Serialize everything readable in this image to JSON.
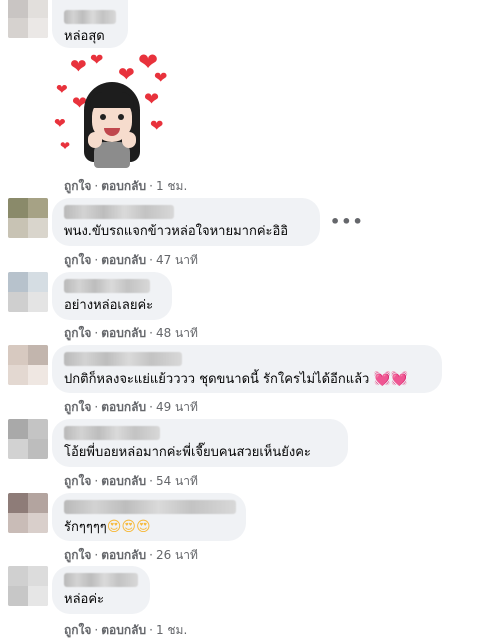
{
  "labels": {
    "like": "ถูกใจ",
    "reply": "ตอบกลับ",
    "separator": "·"
  },
  "comments": [
    {
      "text": "หล่อสุด",
      "time": ""
    },
    {
      "text": "",
      "time": "1 ชม.",
      "sticker": "heart-eyes-girl-avatar-sticker"
    },
    {
      "text": "พนง.ขับรถแจกข้าวหล่อใจหายมากค่ะอิอิ",
      "time": "47 นาที",
      "more": "•••"
    },
    {
      "text": "อย่างหล่อเลยค่ะ",
      "time": "48 นาที"
    },
    {
      "text": "ปกติก็หลงจะแย่แย้วววว ชุดขนาดนี้ รักใครไม่ได้อีกแล้ว",
      "emoji": "💓💓",
      "time": "49 นาที"
    },
    {
      "text": "โอ้ยพี่บอยหล่อมากค่ะพี่เจี๊ยบคนสวยเห็นยังคะ",
      "time": "54 นาที"
    },
    {
      "text": "รักๆๆๆๆ",
      "emoji": "😍😍😍",
      "time": "26 นาที"
    },
    {
      "text": "หล่อค่ะ",
      "time": "1 ชม."
    }
  ],
  "colors": {
    "bubble": "#f0f2f5",
    "meta": "#65676b",
    "heart": "#e8323c"
  }
}
